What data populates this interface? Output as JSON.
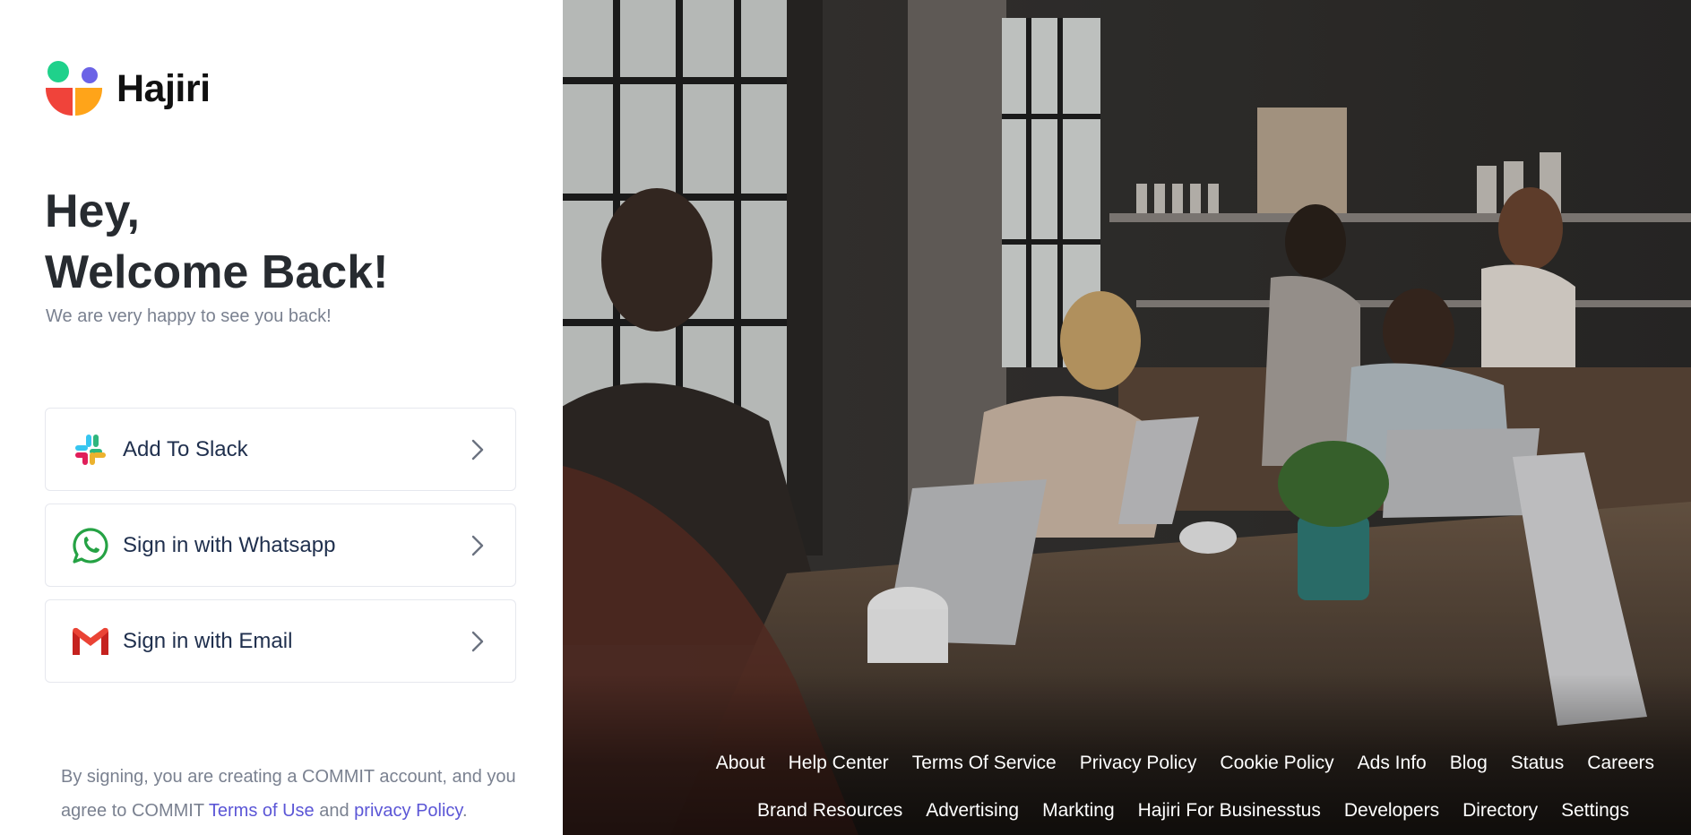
{
  "brand": {
    "name": "Hajiri",
    "colors": {
      "green": "#1fd18b",
      "purple": "#6b63e6",
      "red": "#f0433a",
      "orange": "#ffa419"
    }
  },
  "greeting": {
    "line1": "Hey,",
    "line2": "Welcome Back!",
    "subtitle": "We are very happy to see you back!"
  },
  "signin_options": [
    {
      "label": "Add To Slack",
      "icon": "slack-icon"
    },
    {
      "label": "Sign in with Whatsapp",
      "icon": "whatsapp-icon"
    },
    {
      "label": "Sign in with Email",
      "icon": "gmail-icon"
    }
  ],
  "legal": {
    "text1": "By signing, you are creating a COMMIT account, and you agree to COMMIT ",
    "terms_link": "Terms of Use",
    "and": " and ",
    "privacy_link": "privacy Policy",
    "end": "."
  },
  "footer": {
    "row1": [
      "About",
      "Help Center",
      "Terms Of Service",
      "Privacy Policy",
      "Cookie Policy",
      "Ads Info",
      "Blog",
      "Status",
      "Careers"
    ],
    "row2": [
      "Brand Resources",
      "Advertising",
      "Markting",
      "Hajiri For Businesstus",
      "Developers",
      "Directory",
      "Settings"
    ]
  }
}
